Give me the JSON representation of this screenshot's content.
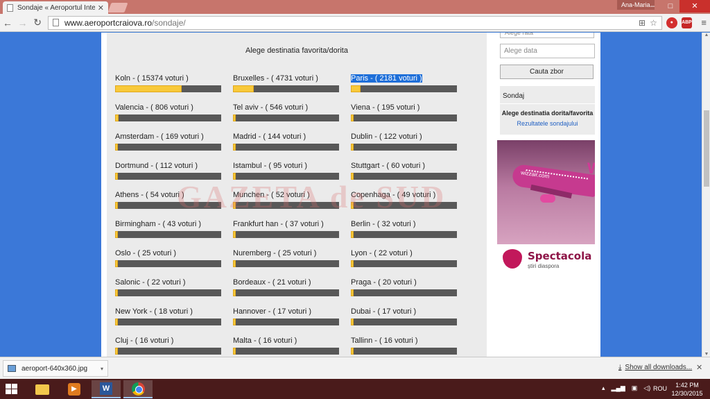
{
  "browser": {
    "tab_title": "Sondaje « Aeroportul Inter",
    "user": "Ana-Maria",
    "url_host": "www.aeroportcraiova.ro",
    "url_path": "/sondaje/"
  },
  "poll": {
    "heading": "Alege destinatia favorita/dorita",
    "max_votes": 15374,
    "items": [
      {
        "label": "Koln - ( 15374 voturi )",
        "votes": 15374
      },
      {
        "label": "Bruxelles - ( 4731 voturi )",
        "votes": 4731
      },
      {
        "label": "Paris - ( 2181 voturi )",
        "votes": 2181,
        "selected": true
      },
      {
        "label": "Valencia - ( 806 voturi )",
        "votes": 806
      },
      {
        "label": "Tel aviv - ( 546 voturi )",
        "votes": 546
      },
      {
        "label": "Viena - ( 195 voturi )",
        "votes": 195
      },
      {
        "label": "Amsterdam - ( 169 voturi )",
        "votes": 169
      },
      {
        "label": "Madrid - ( 144 voturi )",
        "votes": 144
      },
      {
        "label": "Dublin - ( 122 voturi )",
        "votes": 122
      },
      {
        "label": "Dortmund - ( 112 voturi )",
        "votes": 112
      },
      {
        "label": "Istambul - ( 95 voturi )",
        "votes": 95
      },
      {
        "label": "Stuttgart - ( 60 voturi )",
        "votes": 60
      },
      {
        "label": "Athens - ( 54 voturi )",
        "votes": 54
      },
      {
        "label": "Munchen - ( 52 voturi )",
        "votes": 52
      },
      {
        "label": "Copenhaga - ( 49 voturi )",
        "votes": 49
      },
      {
        "label": "Birmingham - ( 43 voturi )",
        "votes": 43
      },
      {
        "label": "Frankfurt han - ( 37 voturi )",
        "votes": 37
      },
      {
        "label": "Berlin - ( 32 voturi )",
        "votes": 32
      },
      {
        "label": "Oslo - ( 25 voturi )",
        "votes": 25
      },
      {
        "label": "Nuremberg - ( 25 voturi )",
        "votes": 25
      },
      {
        "label": "Lyon - ( 22 voturi )",
        "votes": 22
      },
      {
        "label": "Salonic - ( 22 voturi )",
        "votes": 22
      },
      {
        "label": "Bordeaux - ( 21 voturi )",
        "votes": 21
      },
      {
        "label": "Praga - ( 20 voturi )",
        "votes": 20
      },
      {
        "label": "New York - ( 18 voturi )",
        "votes": 18
      },
      {
        "label": "Hannover - ( 17 voturi )",
        "votes": 17
      },
      {
        "label": "Dubai - ( 17 voturi )",
        "votes": 17
      },
      {
        "label": "Cluj - ( 16 voturi )",
        "votes": 16
      },
      {
        "label": "Malta - ( 16 voturi )",
        "votes": 16
      },
      {
        "label": "Tallinn - ( 16 voturi )",
        "votes": 16
      }
    ]
  },
  "sidebar": {
    "select_fare": "Alege rata",
    "date_placeholder": "Alege data",
    "search_button": "Cauta zbor",
    "survey_title": "Sondaj",
    "survey_question": "Alege destinatia dorita/favorita",
    "survey_results": "Rezultatele sondajului",
    "ad_brand": "wizzair.com",
    "ad_tail": "W",
    "spectacola_title": "Spectacola",
    "spectacola_subtitle": "știri diaspora"
  },
  "watermark": "GAZETA de SUD",
  "downloads": {
    "file": "aeroport-640x360.jpg",
    "show_all": "Show all downloads..."
  },
  "taskbar": {
    "lang": "ROU",
    "time": "1:42 PM",
    "date": "12/30/2015"
  },
  "colors": {
    "bar_fill": "#f8c93a",
    "bar_track": "#585858",
    "selection": "#1e6fd9",
    "page_bg": "#3b78d8"
  }
}
